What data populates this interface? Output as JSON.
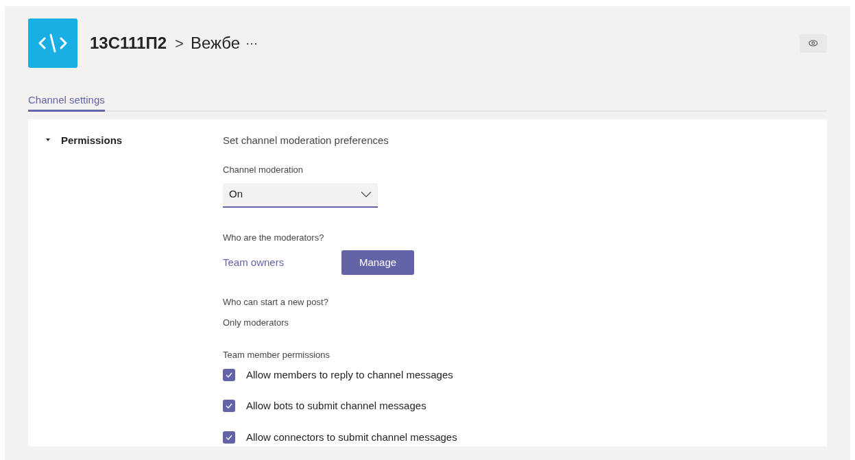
{
  "header": {
    "team": "13C111П2",
    "separator": ">",
    "channel": "Вежбе",
    "more": "···"
  },
  "tabs": [
    {
      "label": "Channel settings",
      "selected": true
    }
  ],
  "section": {
    "title": "Permissions",
    "expanded": true,
    "intro": "Set channel moderation preferences",
    "moderation": {
      "label": "Channel moderation",
      "value": "On"
    },
    "moderators": {
      "label": "Who are the moderators?",
      "value": "Team owners",
      "button": "Manage"
    },
    "new_post": {
      "label": "Who can start a new post?",
      "value": "Only moderators"
    },
    "permissions": {
      "label": "Team member permissions",
      "items": [
        {
          "label": "Allow members to reply to channel messages",
          "checked": true
        },
        {
          "label": "Allow bots to submit channel messages",
          "checked": true
        },
        {
          "label": "Allow connectors to submit channel messages",
          "checked": true
        }
      ]
    }
  }
}
